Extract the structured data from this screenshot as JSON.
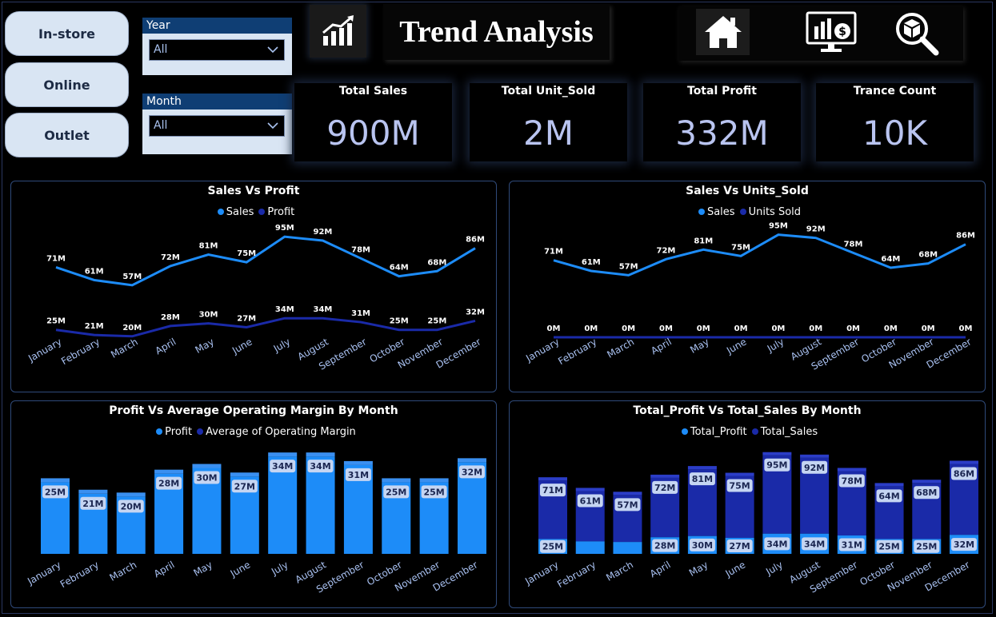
{
  "nav": {
    "buttons": [
      "In-store",
      "Online",
      "Outlet"
    ]
  },
  "filters": {
    "year": {
      "label": "Year",
      "value": "All"
    },
    "month": {
      "label": "Month",
      "value": "All"
    }
  },
  "header": {
    "title": "Trend Analysis"
  },
  "icons": {
    "trend": "trend-chart-icon",
    "home": "home-icon",
    "finance": "finance-monitor-icon",
    "search": "box-search-icon"
  },
  "kpis": [
    {
      "label": "Total Sales",
      "value": "900M"
    },
    {
      "label": "Total Unit_Sold",
      "value": "2M"
    },
    {
      "label": "Total Profit",
      "value": "332M"
    },
    {
      "label": "Trance Count",
      "value": "10K"
    }
  ],
  "colors": {
    "light_blue": "#1d8cf8",
    "dark_blue": "#1a2aa8",
    "kpi_value": "#b9c4f0",
    "months": "#a8c0f0"
  },
  "chart_data": [
    {
      "type": "line",
      "title": "Sales Vs Profit",
      "categories": [
        "January",
        "February",
        "March",
        "April",
        "May",
        "June",
        "July",
        "August",
        "September",
        "October",
        "November",
        "December"
      ],
      "series": [
        {
          "name": "Sales",
          "values": [
            71,
            61,
            57,
            72,
            81,
            75,
            95,
            92,
            78,
            64,
            68,
            86
          ],
          "labels": [
            "71M",
            "61M",
            "57M",
            "72M",
            "81M",
            "75M",
            "95M",
            "92M",
            "78M",
            "64M",
            "68M",
            "86M"
          ]
        },
        {
          "name": "Profit",
          "values": [
            25,
            21,
            20,
            28,
            30,
            27,
            34,
            34,
            31,
            25,
            25,
            32
          ],
          "labels": [
            "25M",
            "21M",
            "20M",
            "28M",
            "30M",
            "27M",
            "34M",
            "34M",
            "31M",
            "25M",
            "25M",
            "32M"
          ]
        }
      ]
    },
    {
      "type": "line",
      "title": "Sales Vs Units_Sold",
      "categories": [
        "January",
        "February",
        "March",
        "April",
        "May",
        "June",
        "July",
        "August",
        "September",
        "October",
        "November",
        "December"
      ],
      "series": [
        {
          "name": "Sales",
          "values": [
            71,
            61,
            57,
            72,
            81,
            75,
            95,
            92,
            78,
            64,
            68,
            86
          ],
          "labels": [
            "71M",
            "61M",
            "57M",
            "72M",
            "81M",
            "75M",
            "95M",
            "92M",
            "78M",
            "64M",
            "68M",
            "86M"
          ]
        },
        {
          "name": "Units Sold",
          "values": [
            0,
            0,
            0,
            0,
            0,
            0,
            0,
            0,
            0,
            0,
            0,
            0
          ],
          "labels": [
            "0M",
            "0M",
            "0M",
            "0M",
            "0M",
            "0M",
            "0M",
            "0M",
            "0M",
            "0M",
            "0M",
            "0M"
          ]
        }
      ]
    },
    {
      "type": "bar",
      "title": "Profit Vs Average Operating Margin By Month",
      "categories": [
        "January",
        "February",
        "March",
        "April",
        "May",
        "June",
        "July",
        "August",
        "September",
        "October",
        "November",
        "December"
      ],
      "series": [
        {
          "name": "Profit",
          "values": [
            25,
            21,
            20,
            28,
            30,
            27,
            34,
            34,
            31,
            25,
            25,
            32
          ],
          "labels": [
            "25M",
            "21M",
            "20M",
            "28M",
            "30M",
            "27M",
            "34M",
            "34M",
            "31M",
            "25M",
            "25M",
            "32M"
          ]
        },
        {
          "name": "Average of Operating Margin",
          "values": [
            0.4,
            0.4,
            0.4,
            0.4,
            0.4,
            0.4,
            0.4,
            0.4,
            0.4,
            0.4,
            0.4,
            0.4
          ]
        }
      ]
    },
    {
      "type": "bar",
      "title": "Total_Profit Vs Total_Sales By Month",
      "categories": [
        "January",
        "February",
        "March",
        "April",
        "May",
        "June",
        "July",
        "August",
        "September",
        "October",
        "November",
        "December"
      ],
      "series": [
        {
          "name": "Total_Profit",
          "values": [
            25,
            21,
            20,
            28,
            30,
            27,
            34,
            34,
            31,
            25,
            25,
            32
          ],
          "labels": [
            "25M",
            "",
            "",
            "28M",
            "30M",
            "27M",
            "34M",
            "34M",
            "31M",
            "25M",
            "25M",
            "32M"
          ]
        },
        {
          "name": "Total_Sales",
          "values": [
            71,
            61,
            57,
            72,
            81,
            75,
            95,
            92,
            78,
            64,
            68,
            86
          ],
          "labels": [
            "71M",
            "61M",
            "57M",
            "72M",
            "81M",
            "75M",
            "95M",
            "92M",
            "78M",
            "64M",
            "68M",
            "86M"
          ]
        }
      ]
    }
  ]
}
